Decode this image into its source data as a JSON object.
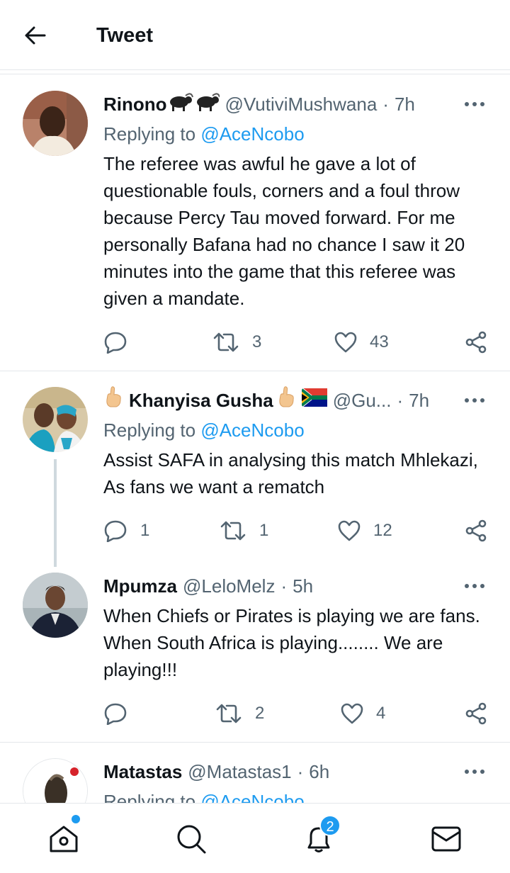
{
  "header": {
    "title": "Tweet",
    "back_icon": "arrow-left-icon"
  },
  "tweets": [
    {
      "name": "Rinono",
      "handle": "@VutiviMushwana",
      "time": "7h",
      "replying_prefix": "Replying to ",
      "replying_to": "@AceNcobo",
      "text": "The referee was awful he gave a lot of questionable fouls, corners and a foul throw because Percy Tau moved forward. For me personally Bafana had no chance I saw it 20 minutes into the game that this referee was given a mandate.",
      "replies": "",
      "retweets": "3",
      "likes": "43"
    },
    {
      "name": "Khanyisa Gusha",
      "handle": "@Gu...",
      "time": "7h",
      "replying_prefix": "Replying to ",
      "replying_to": "@AceNcobo",
      "text": "Assist SAFA in analysing this match Mhlekazi, As fans we want a rematch",
      "replies": "1",
      "retweets": "1",
      "likes": "12"
    },
    {
      "name": "Mpumza",
      "handle": "@LeloMelz",
      "time": "5h",
      "text": "When Chiefs or Pirates is playing we are fans. When South Africa is playing........ We are playing!!!",
      "replies": "",
      "retweets": "2",
      "likes": "4"
    },
    {
      "name": "Matastas",
      "handle": "@Matastas1",
      "time": "6h",
      "replying_prefix": "Replying to ",
      "replying_to": "@AceNcobo"
    }
  ],
  "nav": {
    "items": [
      "home-icon",
      "search-icon",
      "notifications-icon",
      "messages-icon"
    ],
    "notification_count": "2"
  },
  "colors": {
    "accent": "#1d9bf0",
    "muted": "#536471",
    "text": "#0f1419",
    "border": "#e4e7ea"
  }
}
